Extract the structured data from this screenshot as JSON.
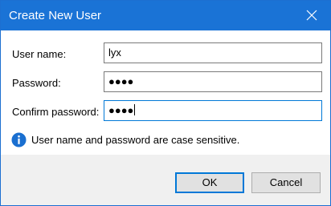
{
  "window": {
    "title": "Create New User",
    "close_icon": "close-icon"
  },
  "form": {
    "username_label": "User name:",
    "username_value": "lyx",
    "password_label": "Password:",
    "password_value": "●●●●",
    "confirm_label": "Confirm password:",
    "confirm_value": "●●●●"
  },
  "info": {
    "icon": "info-icon",
    "text": "User name and password are case sensitive."
  },
  "buttons": {
    "ok_label": "OK",
    "cancel_label": "Cancel"
  },
  "colors": {
    "titlebar": "#1a73d6",
    "accent": "#0078d7",
    "info_icon": "#1a6fd0"
  }
}
